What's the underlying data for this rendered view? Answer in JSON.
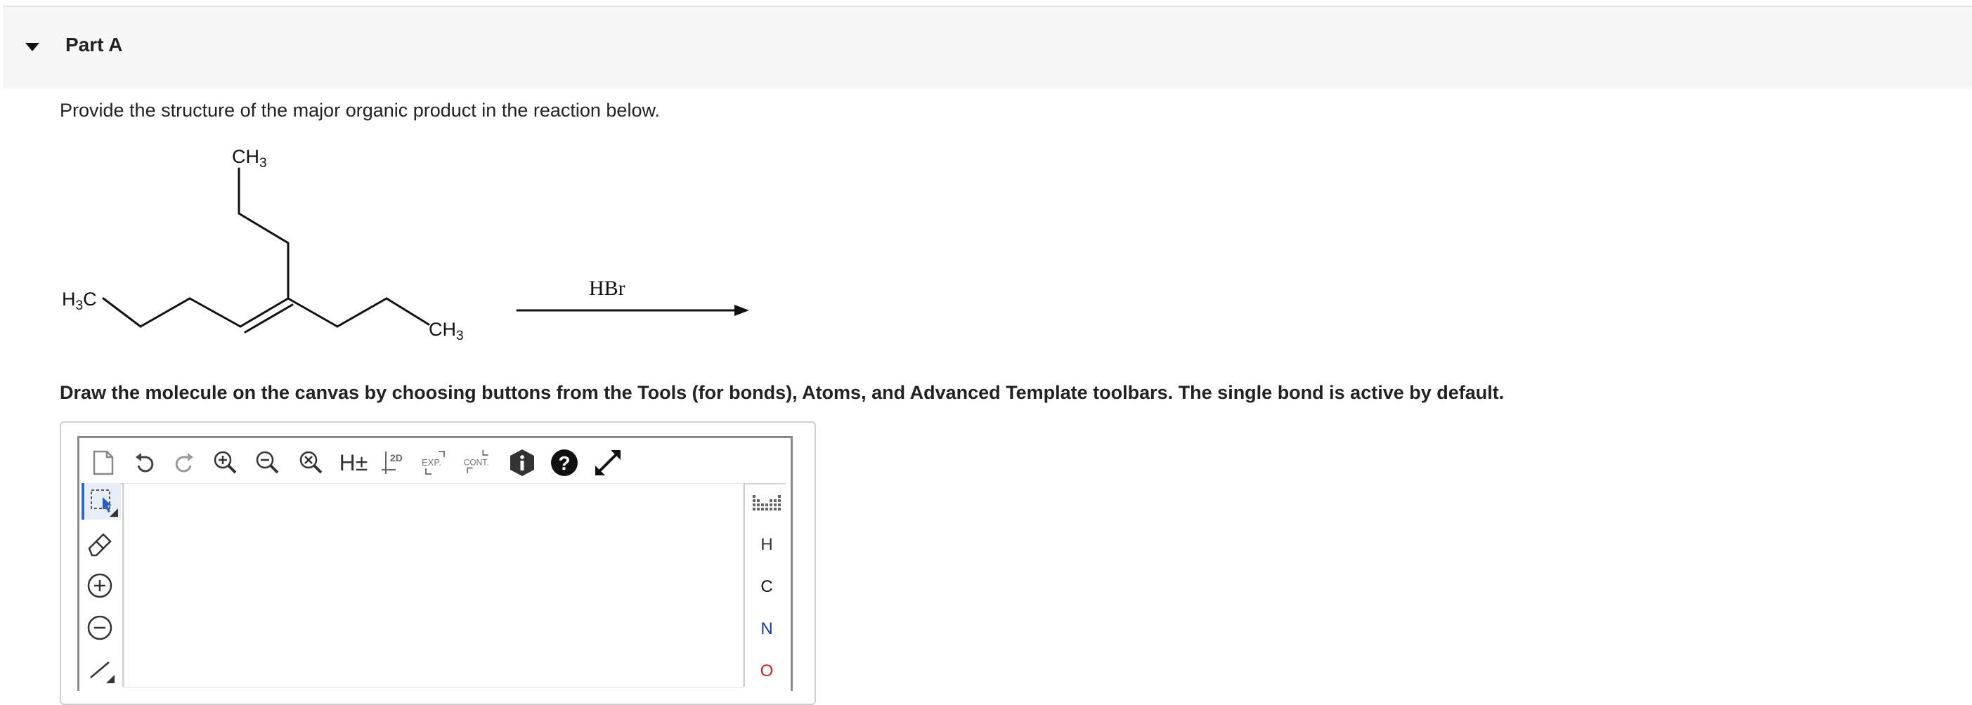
{
  "part": {
    "title": "Part A"
  },
  "question": {
    "text": "Provide the structure of the major organic product in the reaction below."
  },
  "reaction": {
    "labels": {
      "ch3_top": "CH",
      "ch3_top_sub": "3",
      "h3c_left_h": "H",
      "h3c_left_sub": "3",
      "h3c_left_c": "C",
      "ch3_bottom": "CH",
      "ch3_bottom_sub": "3",
      "reagent": "HBr"
    }
  },
  "instructions": {
    "text": "Draw the molecule on the canvas by choosing buttons from the Tools (for bonds), Atoms, and Advanced Template toolbars. The single bond is active by default."
  },
  "toolbar": {
    "hydrogen_label": "H±",
    "clean2d_label": "2D",
    "expand_label": "EXP.",
    "contract_label": "CONT."
  },
  "atoms": [
    "H",
    "C",
    "N",
    "O"
  ],
  "colors": {
    "header_bg": "#f7f7f7",
    "atom_N": "#1a3a9c",
    "atom_O": "#d02020",
    "selected_accent": "#3367c4"
  },
  "icons": {
    "part_toggle": "triangle-down-icon",
    "new": "new-document-icon",
    "undo": "undo-icon",
    "redo": "redo-icon",
    "zoom_in": "zoom-in-icon",
    "zoom_out": "zoom-out-icon",
    "zoom_reset": "zoom-reset-icon",
    "info": "info-icon",
    "help": "help-icon",
    "fullscreen": "expand-arrows-icon",
    "select": "select-lasso-icon",
    "erase": "eraser-icon",
    "charge_plus": "charge-plus-icon",
    "charge_minus": "charge-minus-icon",
    "single_bond": "single-bond-icon",
    "periodic_table": "periodic-table-icon"
  }
}
